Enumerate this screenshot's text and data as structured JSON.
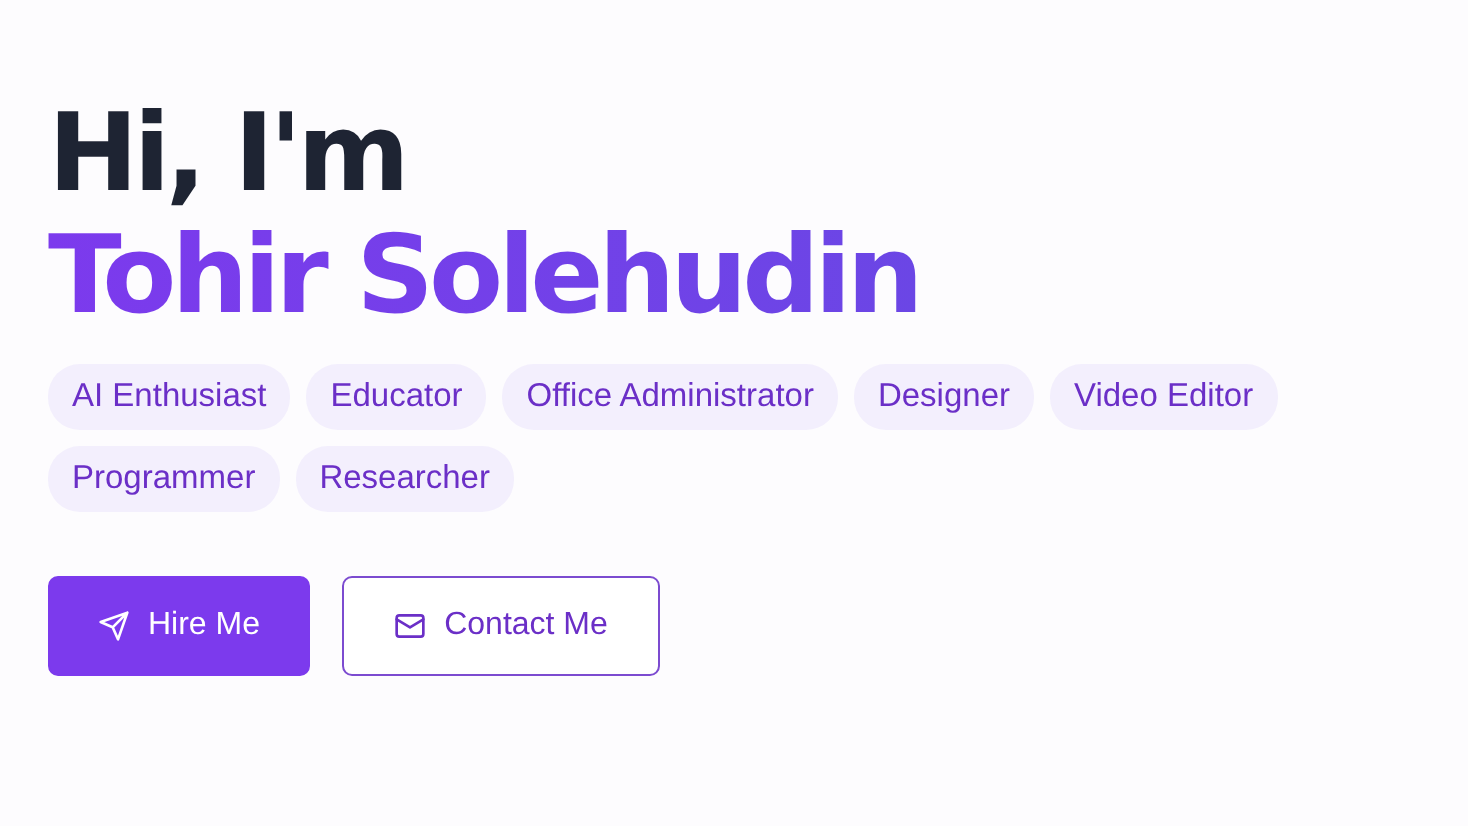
{
  "greeting": "Hi, I'm",
  "name": "Tohir Solehudin",
  "tags": [
    "AI Enthusiast",
    "Educator",
    "Office Administrator",
    "Designer",
    "Video Editor",
    "Programmer",
    "Researcher"
  ],
  "buttons": [
    {
      "label": "Hire Me",
      "kind": "primary"
    },
    {
      "label": "Contact Me",
      "kind": "outline"
    }
  ]
}
